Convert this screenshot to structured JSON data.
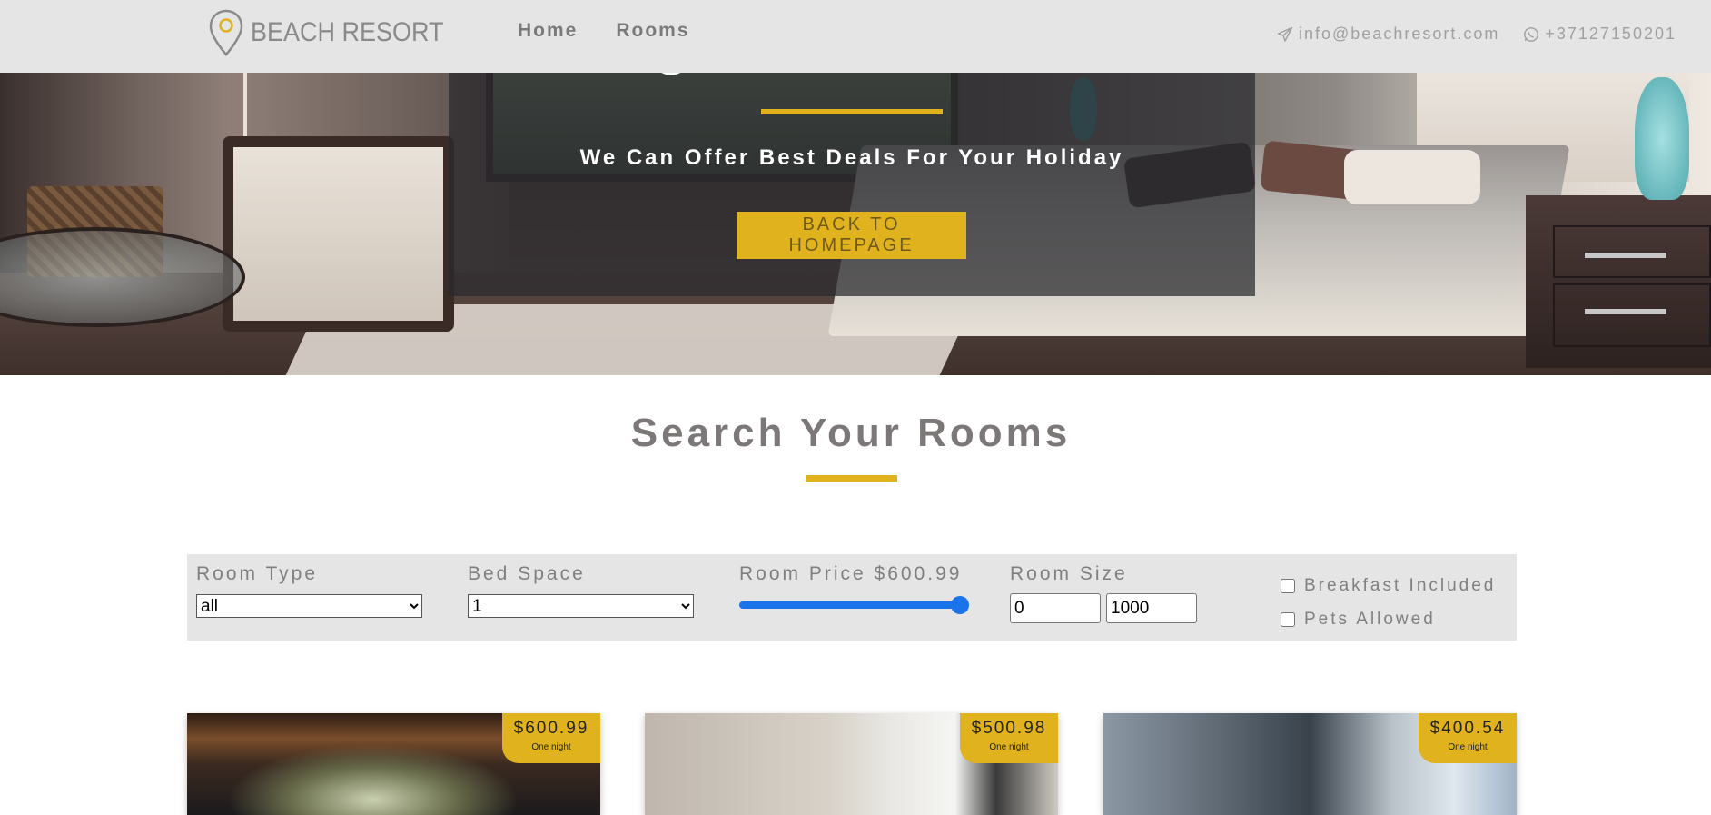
{
  "brand": {
    "name": "BEACH RESORT",
    "accent_color": "#e0b21d",
    "navbar_bg": "#e5e5e5"
  },
  "nav": {
    "links": [
      {
        "label": "Home"
      },
      {
        "label": "Rooms"
      }
    ]
  },
  "contact": {
    "email": "info@beachresort.com",
    "email_icon": "paper-plane-icon",
    "phone": "+37127150201",
    "phone_icon": "whatsapp-icon"
  },
  "hero": {
    "title_fragment": "g",
    "subtitle": "We Can Offer Best Deals For Your Holiday",
    "button_label": "BACK TO HOMEPAGE"
  },
  "search": {
    "title": "Search Your Rooms"
  },
  "filters": {
    "room_type": {
      "label": "Room Type",
      "selected": "all"
    },
    "bed_space": {
      "label": "Bed Space",
      "selected": "1"
    },
    "room_price": {
      "label": "Room Price $600.99",
      "value_fraction": 1.0
    },
    "room_size": {
      "label": "Room Size",
      "min": "0",
      "max": "1000"
    },
    "checkboxes": [
      {
        "label": "Breakfast Included",
        "checked": false
      },
      {
        "label": "Pets Allowed",
        "checked": false
      }
    ]
  },
  "rooms": [
    {
      "price": "$600.99",
      "per": "One night"
    },
    {
      "price": "$500.98",
      "per": "One night"
    },
    {
      "price": "$400.54",
      "per": "One night"
    }
  ]
}
